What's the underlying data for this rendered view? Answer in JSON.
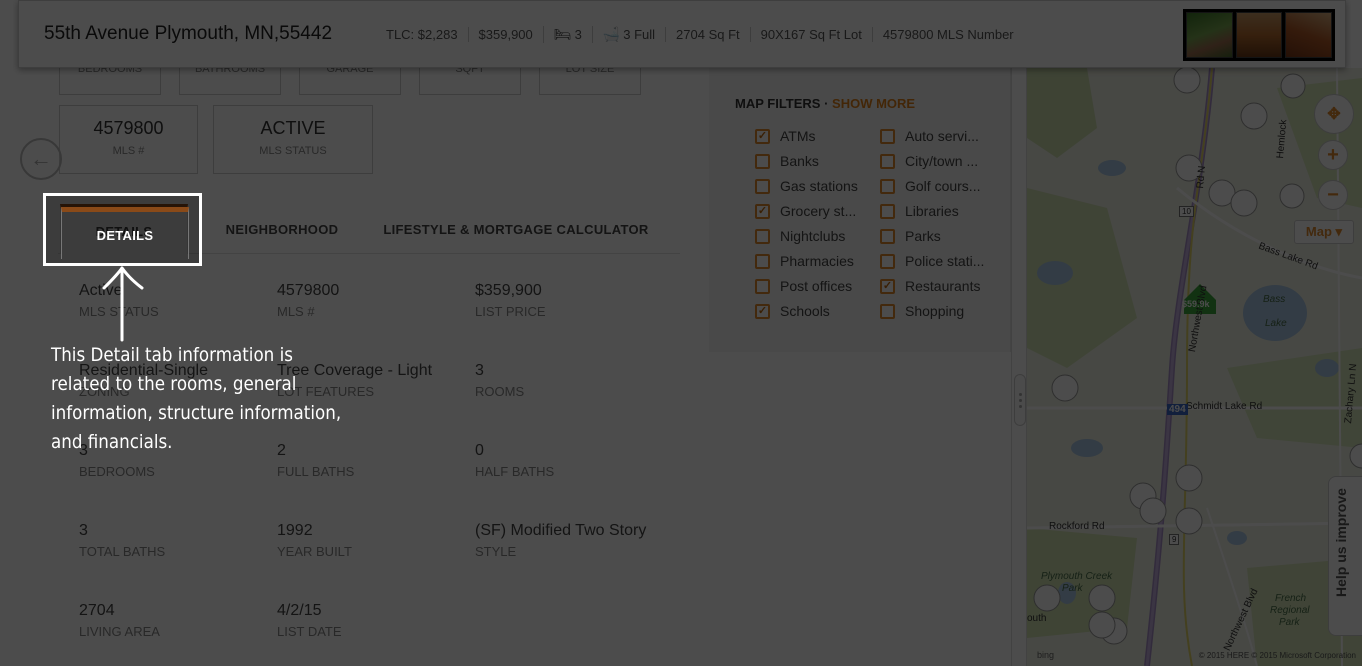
{
  "header": {
    "address": "55th Avenue Plymouth, MN,55442",
    "tlc": "TLC: $2,283",
    "price": "$359,900",
    "beds": "3",
    "baths": "3 Full",
    "sqft": "2704 Sq Ft",
    "lot": "90X167 Sq Ft Lot",
    "mls": "4579800 MLS Number",
    "icons": [
      "bed-icon",
      "bathtub-icon"
    ]
  },
  "summary_partial": [
    "BEDROOMS",
    "BATHROOMS",
    "GARAGE",
    "SQFT",
    "LOT SIZE"
  ],
  "summary_boxes": [
    {
      "value": "4579800",
      "label": "MLS #"
    },
    {
      "value": "ACTIVE",
      "label": "MLS STATUS"
    }
  ],
  "tabs": [
    "DETAILS",
    "NEIGHBORHOOD",
    "LIFESTYLE & MORTGAGE CALCULATOR"
  ],
  "details": [
    {
      "value": "Active",
      "label": "MLS STATUS"
    },
    {
      "value": "4579800",
      "label": "MLS #"
    },
    {
      "value": "$359,900",
      "label": "LIST PRICE"
    },
    {
      "value": "Residential-Single",
      "label": "ZONING"
    },
    {
      "value": "Tree Coverage - Light",
      "label": "LOT FEATURES"
    },
    {
      "value": "3",
      "label": "ROOMS"
    },
    {
      "value": "3",
      "label": "BEDROOMS"
    },
    {
      "value": "2",
      "label": "FULL BATHS"
    },
    {
      "value": "0",
      "label": "HALF BATHS"
    },
    {
      "value": "3",
      "label": "TOTAL BATHS"
    },
    {
      "value": "1992",
      "label": "YEAR BUILT"
    },
    {
      "value": "(SF) Modified Two Story",
      "label": "STYLE"
    },
    {
      "value": "2704",
      "label": "LIVING AREA"
    },
    {
      "value": "4/2/15",
      "label": "LIST DATE"
    }
  ],
  "filters": {
    "title": "MAP FILTERS · ",
    "show_more": "SHOW MORE",
    "items": [
      {
        "label": "ATMs",
        "checked": true
      },
      {
        "label": "Auto servi...",
        "checked": false
      },
      {
        "label": "Banks",
        "checked": false
      },
      {
        "label": "City/town ...",
        "checked": false
      },
      {
        "label": "Gas stations",
        "checked": false
      },
      {
        "label": "Golf cours...",
        "checked": false
      },
      {
        "label": "Grocery st...",
        "checked": true
      },
      {
        "label": "Libraries",
        "checked": false
      },
      {
        "label": "Nightclubs",
        "checked": false
      },
      {
        "label": "Parks",
        "checked": false
      },
      {
        "label": "Pharmacies",
        "checked": false
      },
      {
        "label": "Police stati...",
        "checked": false
      },
      {
        "label": "Post offices",
        "checked": false
      },
      {
        "label": "Restaurants",
        "checked": true
      },
      {
        "label": "Schools",
        "checked": true
      },
      {
        "label": "Shopping",
        "checked": false
      }
    ]
  },
  "map": {
    "type_label": "Map ▾",
    "price_pin": "$59.9k",
    "help": "Help us improve",
    "copyright": "© 2015 HERE   © 2015 Microsoft Corporation",
    "bing": "bing",
    "labels": {
      "bass_lake_rd": "Bass Lake Rd",
      "bass_lake_1": "Bass",
      "bass_lake_2": "Lake",
      "schmidt": "Schmidt Lake Rd",
      "rockford": "Rockford Rd",
      "northwest_blvd": "Northwest Blvd",
      "plymouth_creek_1": "Plymouth Creek",
      "plymouth_creek_2": "Park",
      "french_1": "French",
      "french_2": "Regional",
      "french_3": "Park",
      "nw_blvd2": "Northwest Blvd",
      "zachary": "Zachary Ln N",
      "hemlock": "Hemlock",
      "rd_n": "Rd N",
      "outh": "outh",
      "hwy_494": "494",
      "hwy_10": "10",
      "hwy_9": "9"
    }
  },
  "callout": {
    "text": "This Detail tab information is related to the rooms, general information, structure information, and financials."
  }
}
